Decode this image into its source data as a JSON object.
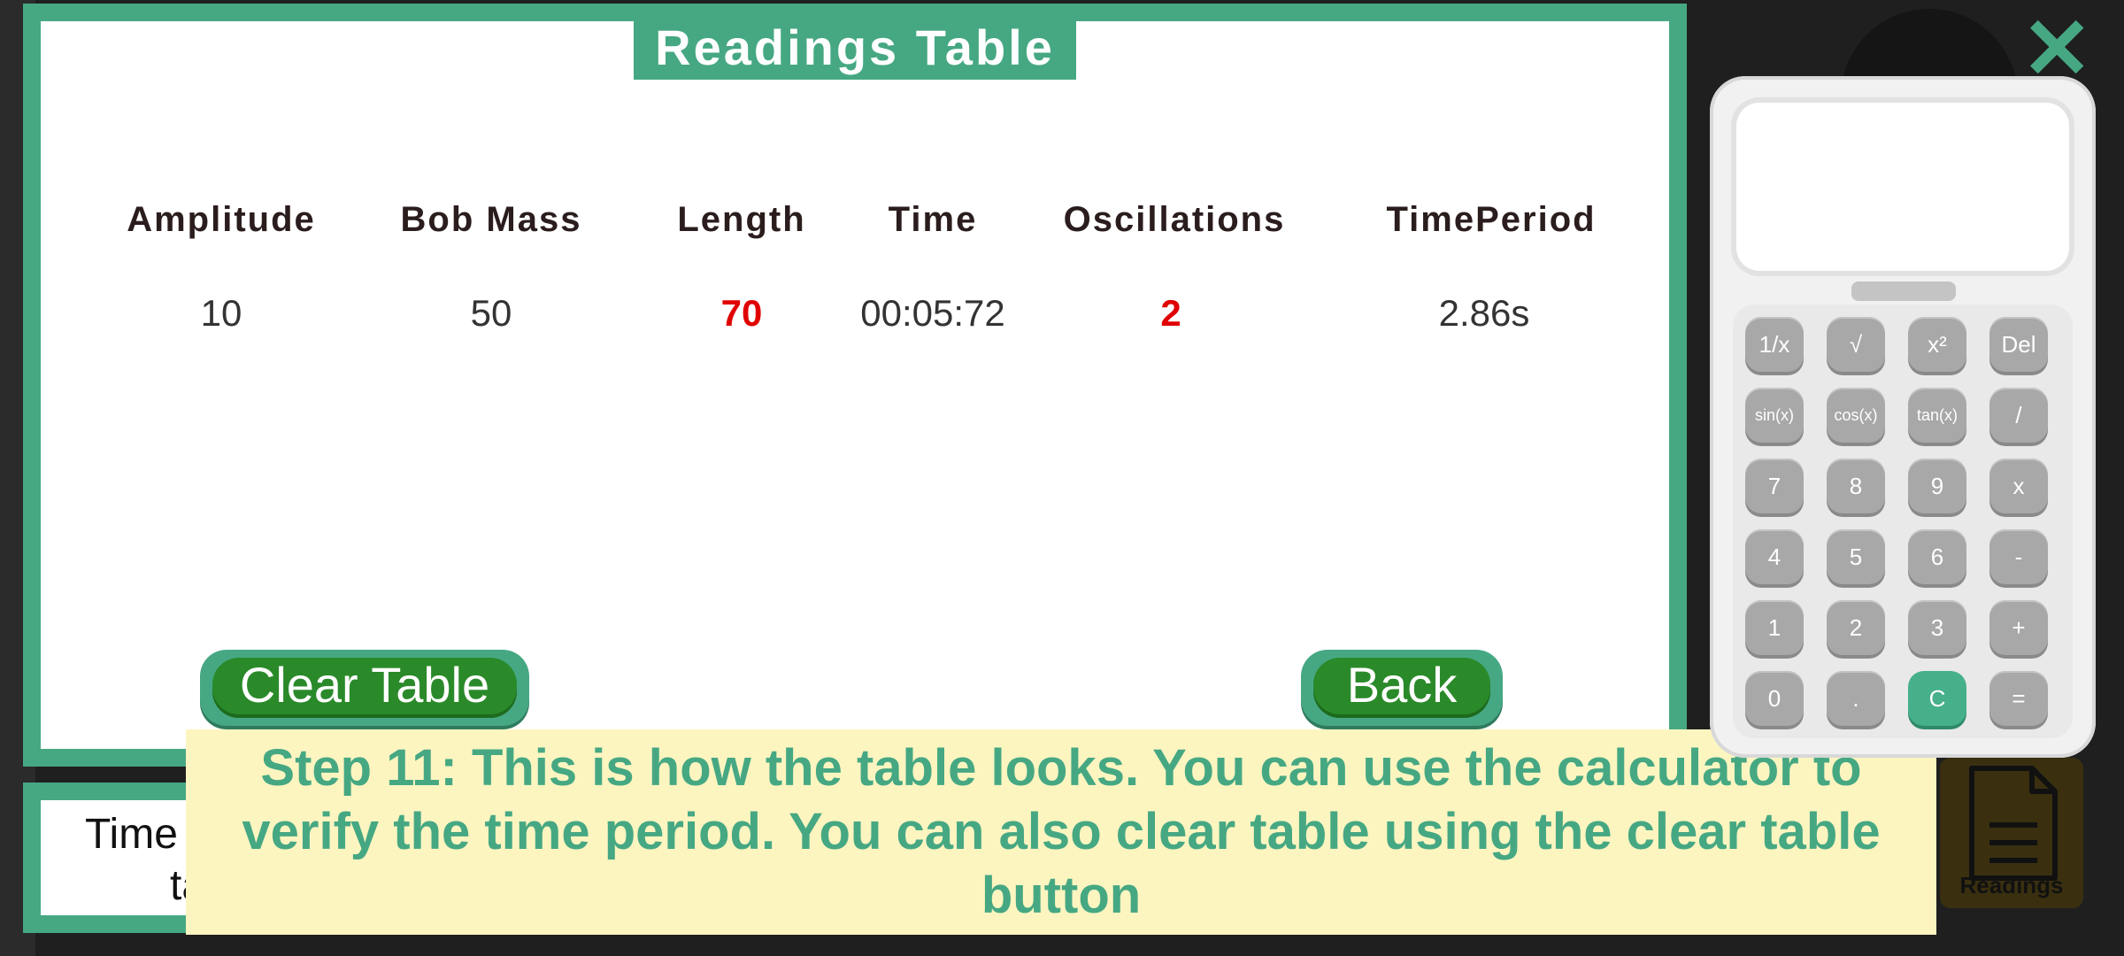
{
  "panel": {
    "title": "Readings Table"
  },
  "table": {
    "headers": [
      "Amplitude",
      "Bob Mass",
      "Length",
      "Time",
      "Oscillations",
      "TimePeriod"
    ],
    "row": [
      "10",
      "50",
      "70",
      "00:05:72",
      "2",
      "2.86s"
    ],
    "highlight_color": "#e00000"
  },
  "buttons": {
    "clear": "Clear Table",
    "back": "Back"
  },
  "lower_box": {
    "line1": "Time",
    "line2": "ta"
  },
  "caption": "Step 11: This is how the table looks. You can use the calculator to verify the time period. You can also clear table using the clear table button",
  "close_icon": "close-icon",
  "readings_tile": {
    "label": "Readings",
    "icon": "document-icon"
  },
  "calculator": {
    "keys": [
      [
        "1/x",
        "√",
        "x²",
        "Del"
      ],
      [
        "sin(x)",
        "cos(x)",
        "tan(x)",
        "/"
      ],
      [
        "7",
        "8",
        "9",
        "x"
      ],
      [
        "4",
        "5",
        "6",
        "-"
      ],
      [
        "1",
        "2",
        "3",
        "+"
      ],
      [
        "0",
        ".",
        "C",
        "="
      ]
    ]
  },
  "colors": {
    "accent": "#46a883",
    "caption_bg": "#fdf5c0",
    "button_green": "#2a8a2a"
  }
}
